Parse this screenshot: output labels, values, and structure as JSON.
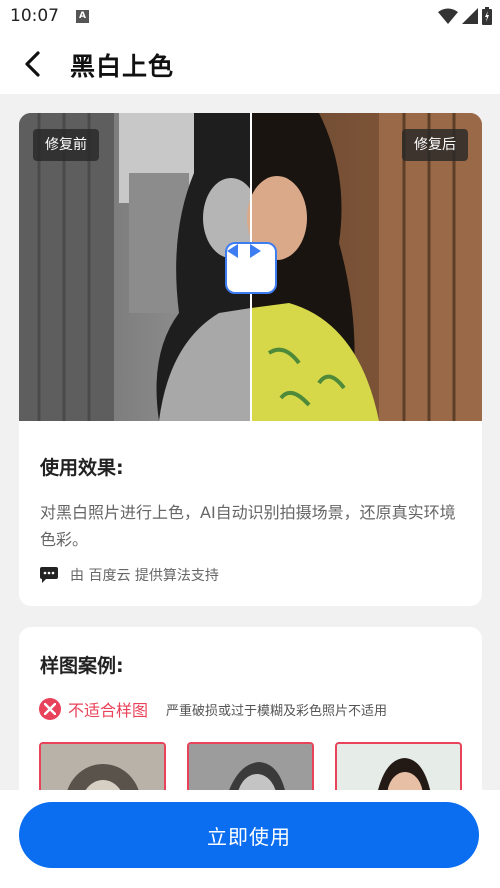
{
  "status": {
    "time": "10:07",
    "notif_badge": "A"
  },
  "header": {
    "title": "黑白上色"
  },
  "compare": {
    "before_label": "修复前",
    "after_label": "修复后"
  },
  "effect": {
    "title": "使用效果:",
    "description": "对黑白照片进行上色，AI自动识别拍摄场景，还原真实环境色彩。",
    "credit": "由 百度云 提供算法支持"
  },
  "samples": {
    "title": "样图案例:",
    "unsuitable_label": "不适合样图",
    "unsuitable_note": "严重破损或过于模糊及彩色照片不适用"
  },
  "action": {
    "use_label": "立即使用"
  },
  "colors": {
    "primary": "#0b6df0",
    "error": "#e8435a",
    "handle_border": "#3e7df1"
  },
  "icons": [
    "wifi-icon",
    "signal-icon",
    "battery-icon",
    "back-arrow-icon",
    "chat-icon",
    "error-x-icon",
    "compare-arrows-icon"
  ]
}
